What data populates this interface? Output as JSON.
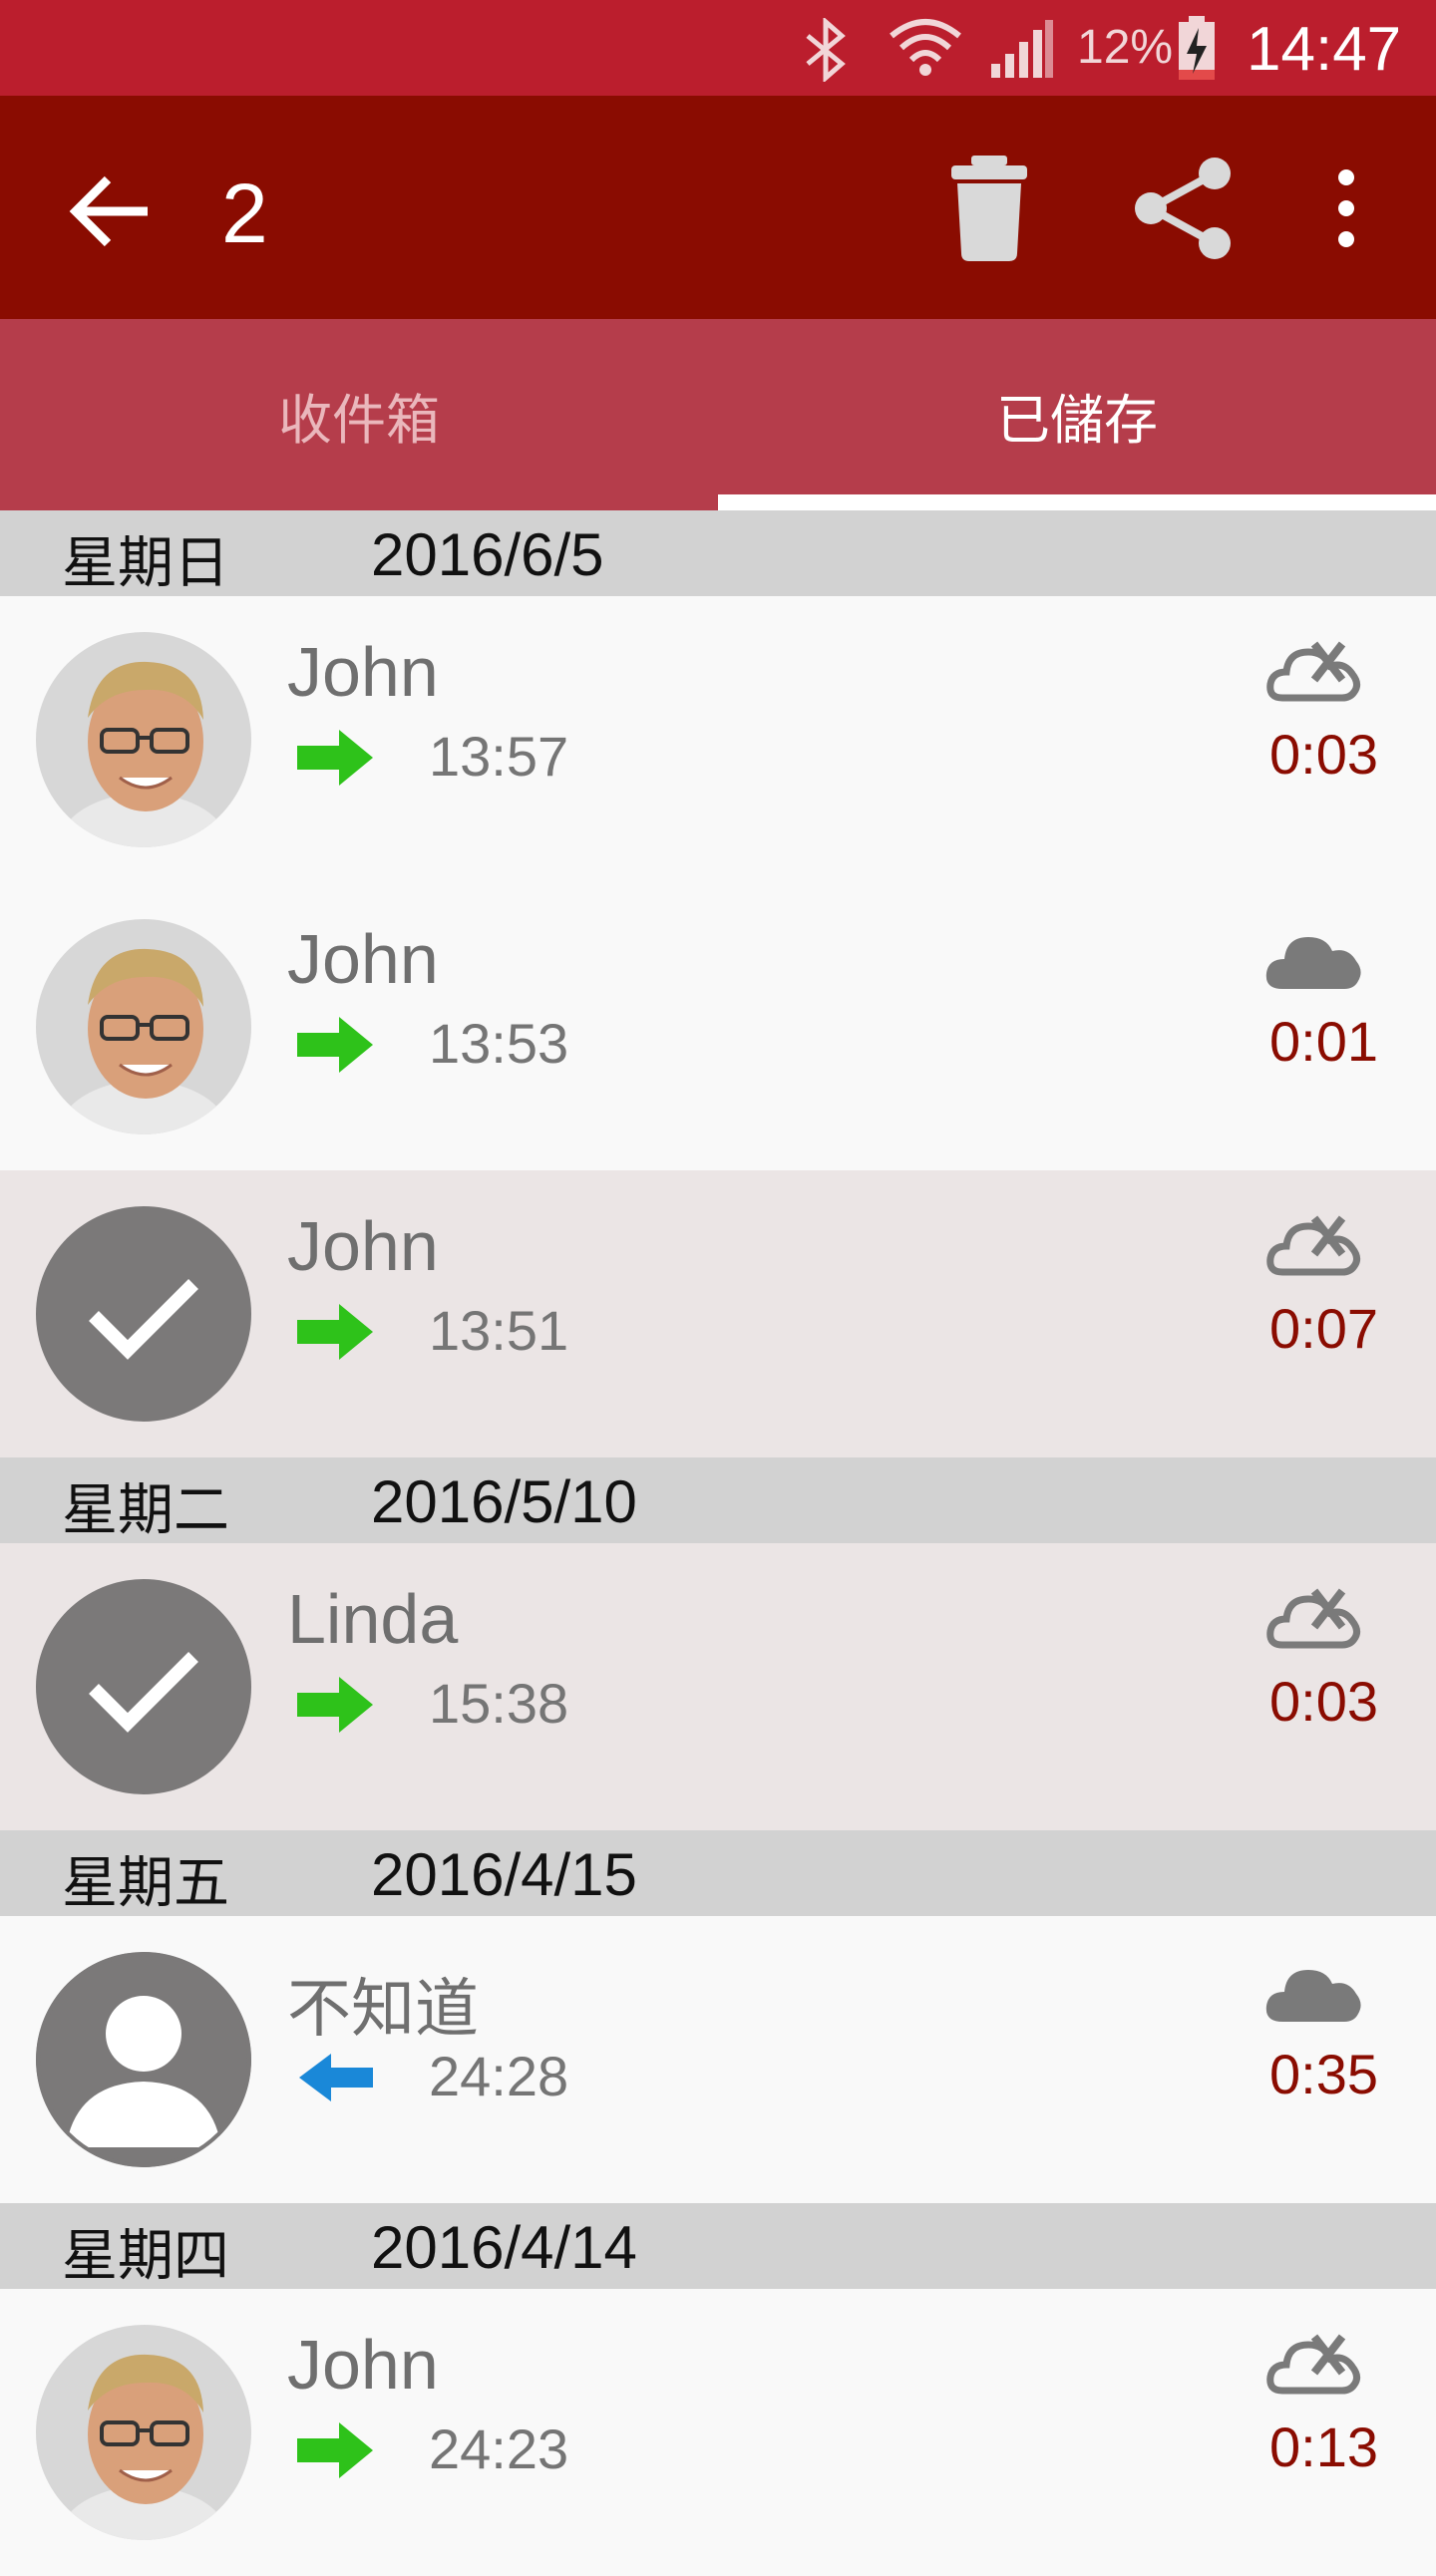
{
  "status_bar": {
    "battery_percent": "12%",
    "time": "14:47",
    "icons": [
      "bluetooth-icon",
      "wifi-icon",
      "signal-icon",
      "battery-charging-icon"
    ]
  },
  "app_bar": {
    "selection_count": "2",
    "actions": [
      "back-icon",
      "delete-icon",
      "share-icon",
      "more-vert-icon"
    ]
  },
  "tabs": [
    {
      "label": "收件箱",
      "active": false
    },
    {
      "label": "已儲存",
      "active": true
    }
  ],
  "colors": {
    "status_bar": "#bb1e2d",
    "app_bar": "#8a0c01",
    "tab_bar": "#b53d4b",
    "outgoing_arrow": "#2ec21a",
    "incoming_arrow": "#1a88d8",
    "duration_text": "#8a0c01"
  },
  "groups": [
    {
      "weekday": "星期日",
      "date": "2016/6/5",
      "calls": [
        {
          "name": "John",
          "direction": "outgoing",
          "time": "13:57",
          "duration": "0:03",
          "cloud": "cloud-off-icon",
          "avatar": "photo",
          "selected": false
        },
        {
          "name": "John",
          "direction": "outgoing",
          "time": "13:53",
          "duration": "0:01",
          "cloud": "cloud-icon",
          "avatar": "photo",
          "selected": false
        },
        {
          "name": "John",
          "direction": "outgoing",
          "time": "13:51",
          "duration": "0:07",
          "cloud": "cloud-off-icon",
          "avatar": "check",
          "selected": true
        }
      ]
    },
    {
      "weekday": "星期二",
      "date": "2016/5/10",
      "calls": [
        {
          "name": "Linda",
          "direction": "outgoing",
          "time": "15:38",
          "duration": "0:03",
          "cloud": "cloud-off-icon",
          "avatar": "check",
          "selected": true
        }
      ]
    },
    {
      "weekday": "星期五",
      "date": "2016/4/15",
      "calls": [
        {
          "name": "不知道",
          "direction": "incoming",
          "time": "24:28",
          "duration": "0:35",
          "cloud": "cloud-icon",
          "avatar": "placeholder",
          "selected": false
        }
      ]
    },
    {
      "weekday": "星期四",
      "date": "2016/4/14",
      "calls": [
        {
          "name": "John",
          "direction": "outgoing",
          "time": "24:23",
          "duration": "0:13",
          "cloud": "cloud-off-icon",
          "avatar": "photo",
          "selected": false
        }
      ]
    }
  ]
}
